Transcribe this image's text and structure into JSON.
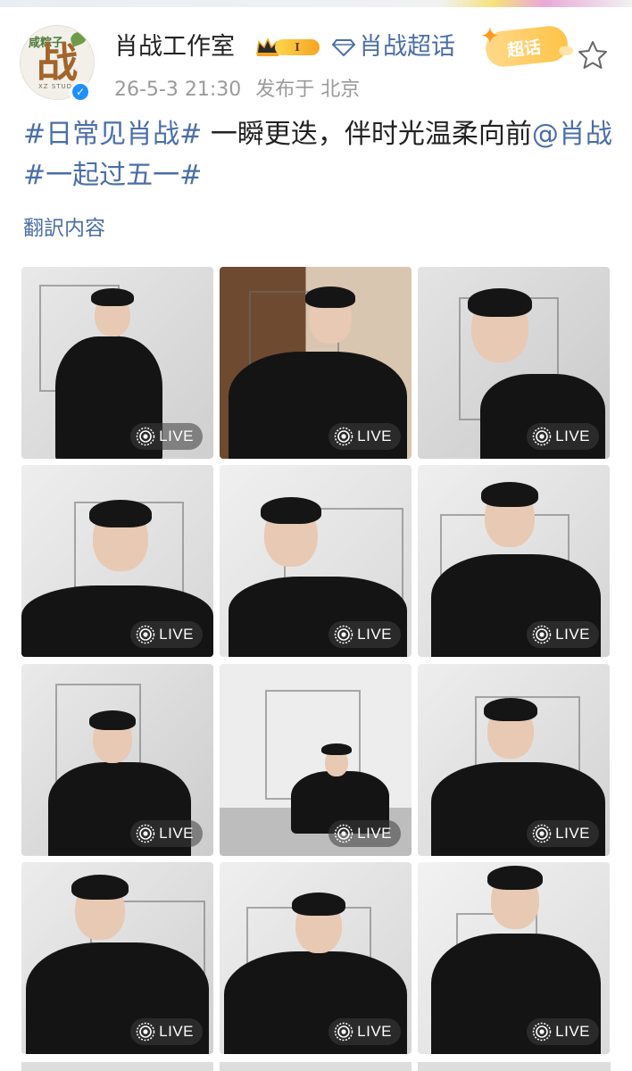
{
  "header": {
    "avatar_logo_top": "咸粽子",
    "avatar_logo_main": "战",
    "avatar_logo_sub": "XZ STUDIO",
    "username": "肖战工作室",
    "level_badge": "I",
    "topic_link": "肖战超话",
    "chaohua_badge": "超话",
    "timestamp": "26-5-3 21:30",
    "location": "发布于 北京"
  },
  "post": {
    "tag1": "#日常见肖战#",
    "text1": " 一瞬更迭，伴时光温柔向前",
    "mention": "@肖战",
    "tag2": "#一起过五一#",
    "translate_label": "翻訳内容"
  },
  "photos": [
    {
      "label": "LIVE"
    },
    {
      "label": "LIVE"
    },
    {
      "label": "LIVE"
    },
    {
      "label": "LIVE"
    },
    {
      "label": "LIVE"
    },
    {
      "label": "LIVE"
    },
    {
      "label": "LIVE"
    },
    {
      "label": "LIVE"
    },
    {
      "label": "LIVE"
    },
    {
      "label": "LIVE"
    },
    {
      "label": "LIVE"
    },
    {
      "label": "LIVE"
    }
  ],
  "colors": {
    "link": "#4a6ea9",
    "verified": "#1f8fff",
    "badge_gold": "#ffc347"
  }
}
